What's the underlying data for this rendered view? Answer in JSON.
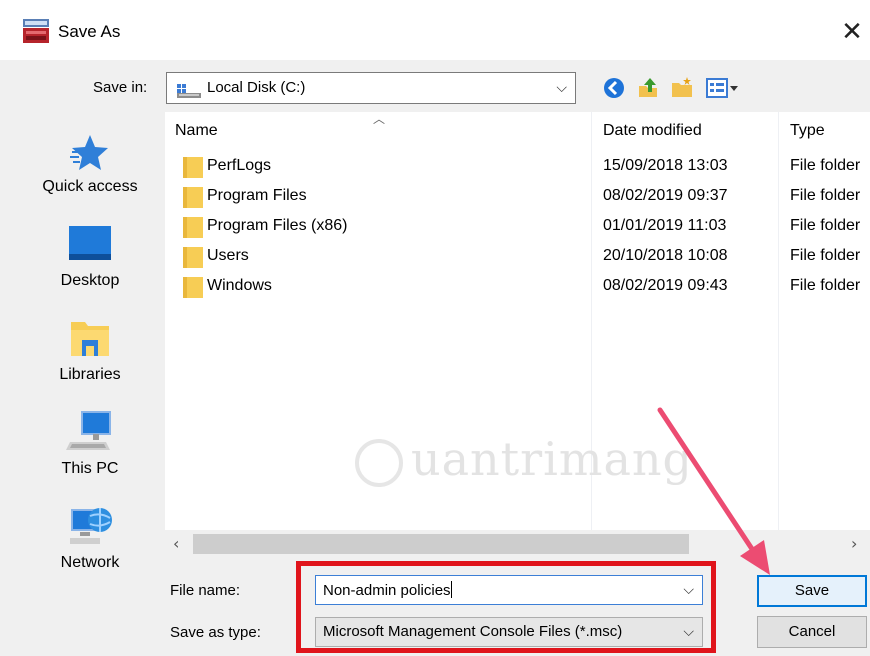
{
  "window": {
    "title": "Save As",
    "close_symbol": "✕"
  },
  "toolbar": {
    "save_in_label": "Save in:",
    "location": "Local Disk (C:)"
  },
  "places": [
    {
      "label": "Quick access",
      "icon": "quick-access-star-icon"
    },
    {
      "label": "Desktop",
      "icon": "desktop-icon"
    },
    {
      "label": "Libraries",
      "icon": "libraries-icon"
    },
    {
      "label": "This PC",
      "icon": "this-pc-icon"
    },
    {
      "label": "Network",
      "icon": "network-icon"
    }
  ],
  "file_list": {
    "columns": [
      "Name",
      "Date modified",
      "Type"
    ],
    "rows": [
      {
        "name": "PerfLogs",
        "date": "15/09/2018 13:03",
        "type": "File folder"
      },
      {
        "name": "Program Files",
        "date": "08/02/2019 09:37",
        "type": "File folder"
      },
      {
        "name": "Program Files (x86)",
        "date": "01/01/2019 11:03",
        "type": "File folder"
      },
      {
        "name": "Users",
        "date": "20/10/2018 10:08",
        "type": "File folder"
      },
      {
        "name": "Windows",
        "date": "08/02/2019 09:43",
        "type": "File folder"
      }
    ]
  },
  "watermark": "uantrimang",
  "form": {
    "file_name_label": "File name:",
    "file_name_value": "Non-admin policies",
    "save_as_type_label": "Save as type:",
    "save_as_type_value": "Microsoft Management Console Files (*.msc)"
  },
  "buttons": {
    "save": "Save",
    "cancel": "Cancel"
  },
  "colors": {
    "highlight_box": "#e0141b",
    "pointer_arrow": "#ec4c72",
    "accent": "#0078d7"
  }
}
